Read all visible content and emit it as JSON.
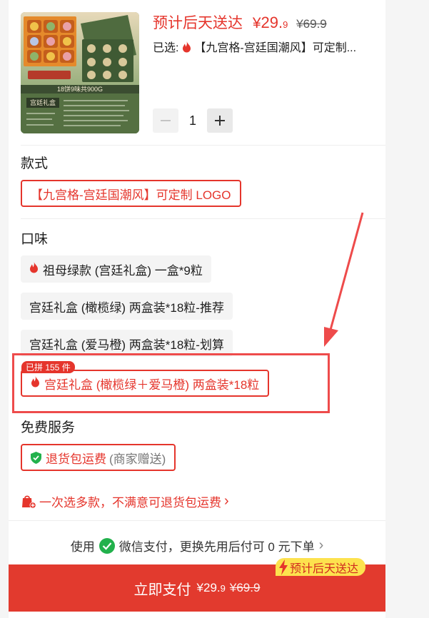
{
  "header": {
    "price_prefix": "预计后天送达",
    "currency": "¥",
    "price_int": "29.",
    "price_dec": "9",
    "original_price": "¥69.9",
    "selected_label": "已选:",
    "selected_value": "【九宫格-宫廷国潮风】可定制...",
    "quantity": "1",
    "image_caption_band": "18饼9味共900G",
    "image_box_title": "宫廷礼盒"
  },
  "style_section": {
    "title": "款式",
    "options": [
      "【九宫格-宫廷国潮风】可定制 LOGO"
    ],
    "selected_index": 0
  },
  "flavor_section": {
    "title": "口味",
    "options": [
      "祖母绿款 (宫廷礼盒) 一盒*9粒",
      "宫廷礼盒 (橄榄绿) 两盒装*18粒-推荐",
      "宫廷礼盒 (爱马橙) 两盒装*18粒-划算",
      "宫廷礼盒 (橄榄绿＋爱马橙) 两盒装*18粒"
    ],
    "selected_index": 3,
    "group_buy_tag": "已拼 155 件"
  },
  "service_section": {
    "title": "免费服务",
    "service_main": "退货包运费",
    "service_note": "(商家赠送)"
  },
  "promo": {
    "text": "一次选多款，不满意可退货包运费",
    "chevron": "›"
  },
  "payment_method": {
    "prefix": "使用",
    "method": "微信支付，更换先用后付可 0 元下单",
    "chevron": "›"
  },
  "pay_button": {
    "label": "立即支付",
    "currency": "¥",
    "amount_int": "29.",
    "amount_dec": "9",
    "original": "¥69.9",
    "delivery_badge": "预计后天送达"
  },
  "colors": {
    "accent": "#e5352c",
    "annotation": "#ee4b4b",
    "pay_bar": "#e23a2e",
    "badge_yellow": "#fde24e",
    "wechat_green": "#22b14c"
  }
}
